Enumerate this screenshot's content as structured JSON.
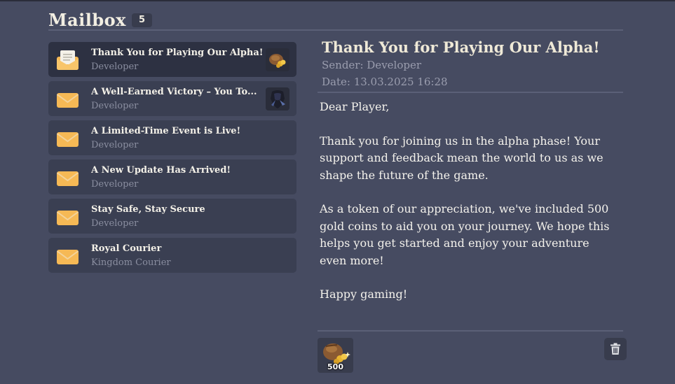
{
  "header": {
    "title": "Mailbox",
    "count": "5"
  },
  "mails": [
    {
      "subject": "Thank You for Playing Our Alpha!",
      "sender": "Developer",
      "icon": "open-letter-icon",
      "attachment": "gold-bag-icon",
      "selected": true
    },
    {
      "subject": "A Well-Earned Victory – You To...",
      "sender": "Developer",
      "icon": "envelope-icon",
      "attachment": "dark-armor-icon",
      "selected": false
    },
    {
      "subject": "A Limited-Time Event is Live!",
      "sender": "Developer",
      "icon": "envelope-icon",
      "selected": false
    },
    {
      "subject": "A New Update Has Arrived!",
      "sender": "Developer",
      "icon": "envelope-icon",
      "selected": false
    },
    {
      "subject": "Stay Safe, Stay Secure",
      "sender": "Developer",
      "icon": "envelope-icon",
      "selected": false
    },
    {
      "subject": "Royal Courier",
      "sender": "Kingdom Courier",
      "icon": "envelope-icon",
      "selected": false
    }
  ],
  "detail": {
    "subject": "Thank You for Playing Our Alpha!",
    "sender": "Sender: Developer",
    "date": "Date: 13.03.2025 16:28",
    "greeting": "Dear Player,",
    "paragraph1": "Thank you for joining us in the alpha phase! Your support and feedback mean the world to us as we shape the future of the game.",
    "paragraph2": "As a token of our appreciation, we've included 500 gold coins to aid you on your journey. We hope this helps you get started and enjoy your adventure even more!",
    "closing": "Happy gaming!"
  },
  "reward": {
    "amount": "500",
    "icon": "gold-bag-icon"
  },
  "colors": {
    "background": "#464b61",
    "item": "#3a3f52",
    "item_selected": "#2d3142",
    "envelope": "#f6b955"
  }
}
